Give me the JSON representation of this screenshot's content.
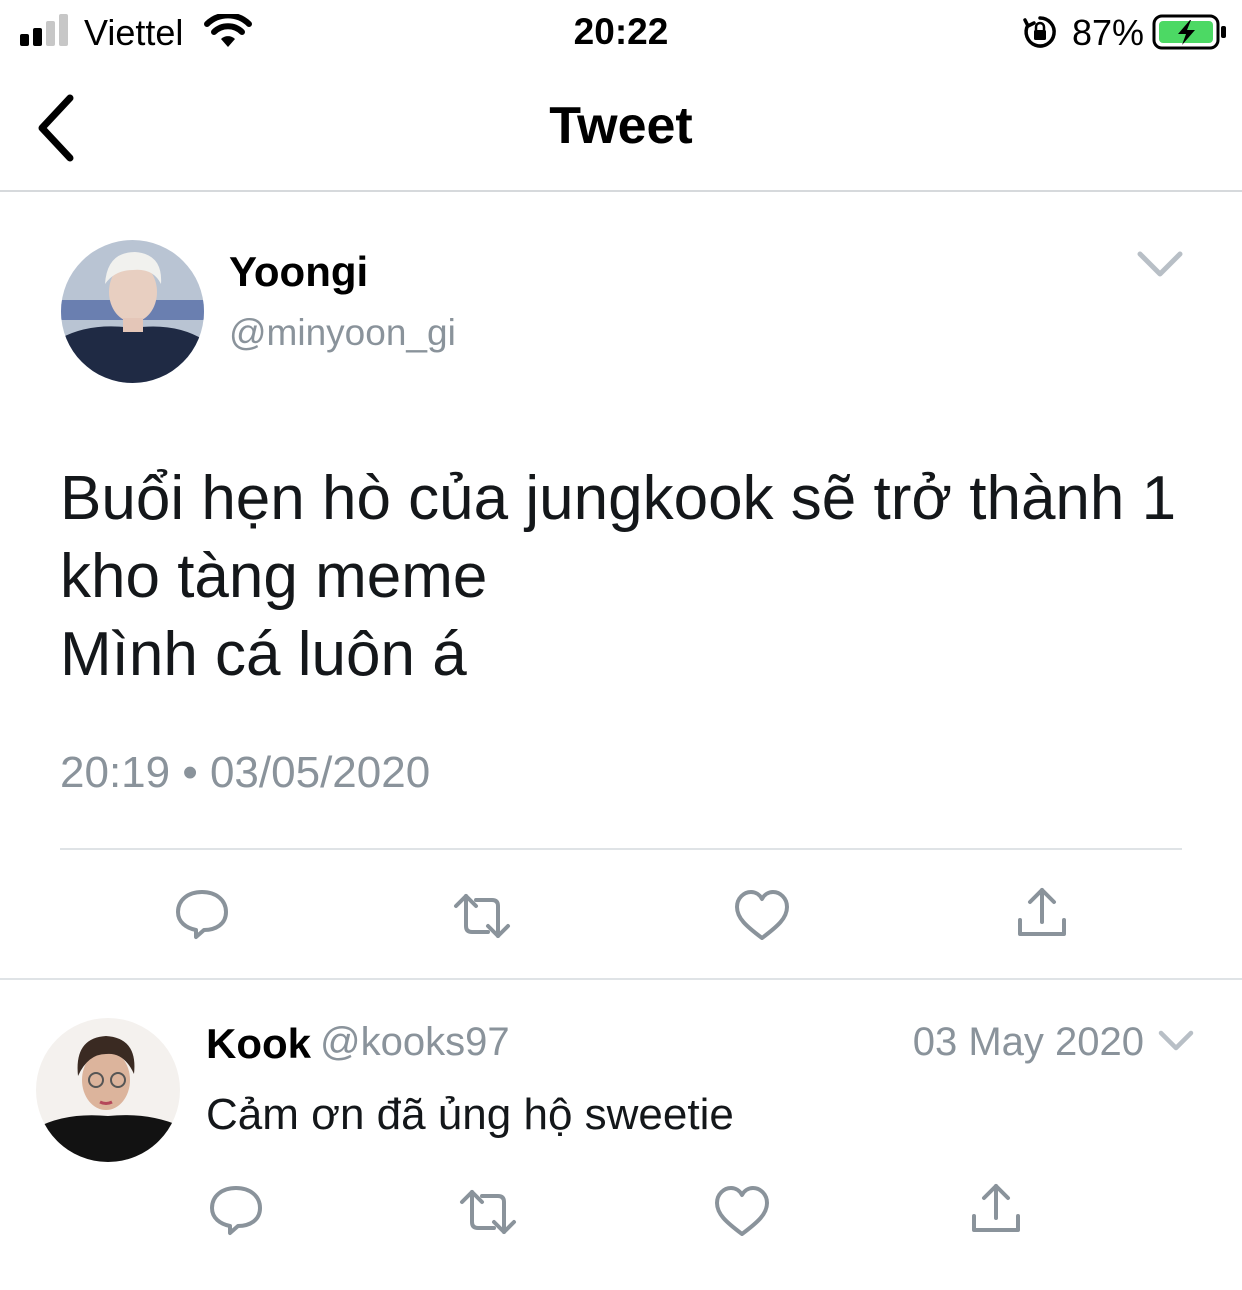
{
  "status_bar": {
    "carrier": "Viettel",
    "time": "20:22",
    "battery_percent": "87%",
    "icons": [
      "signal-icon",
      "wifi-icon",
      "orientation-lock-icon",
      "battery-charging-icon"
    ]
  },
  "nav": {
    "title": "Tweet",
    "back_icon": "chevron-left-icon"
  },
  "main_tweet": {
    "display_name": "Yoongi",
    "handle": "@minyoon_gi",
    "text_lines": [
      "Buổi hẹn hò của jungkook sẽ trở thành 1",
      "kho tàng meme",
      "Mình cá luôn á"
    ],
    "timestamp": "20:19 • 03/05/2020",
    "actions": [
      "reply-icon",
      "retweet-icon",
      "like-icon",
      "share-icon"
    ]
  },
  "reply_tweet": {
    "display_name": "Kook",
    "handle": "@kooks97",
    "date": "03 May 2020",
    "text": "Cảm ơn đã ủng hộ sweetie",
    "actions": [
      "reply-icon",
      "retweet-icon",
      "like-icon",
      "share-icon"
    ]
  },
  "colors": {
    "secondary_text": "#8a939b",
    "divider": "#dfe3e6",
    "battery_green": "#4cd964"
  }
}
